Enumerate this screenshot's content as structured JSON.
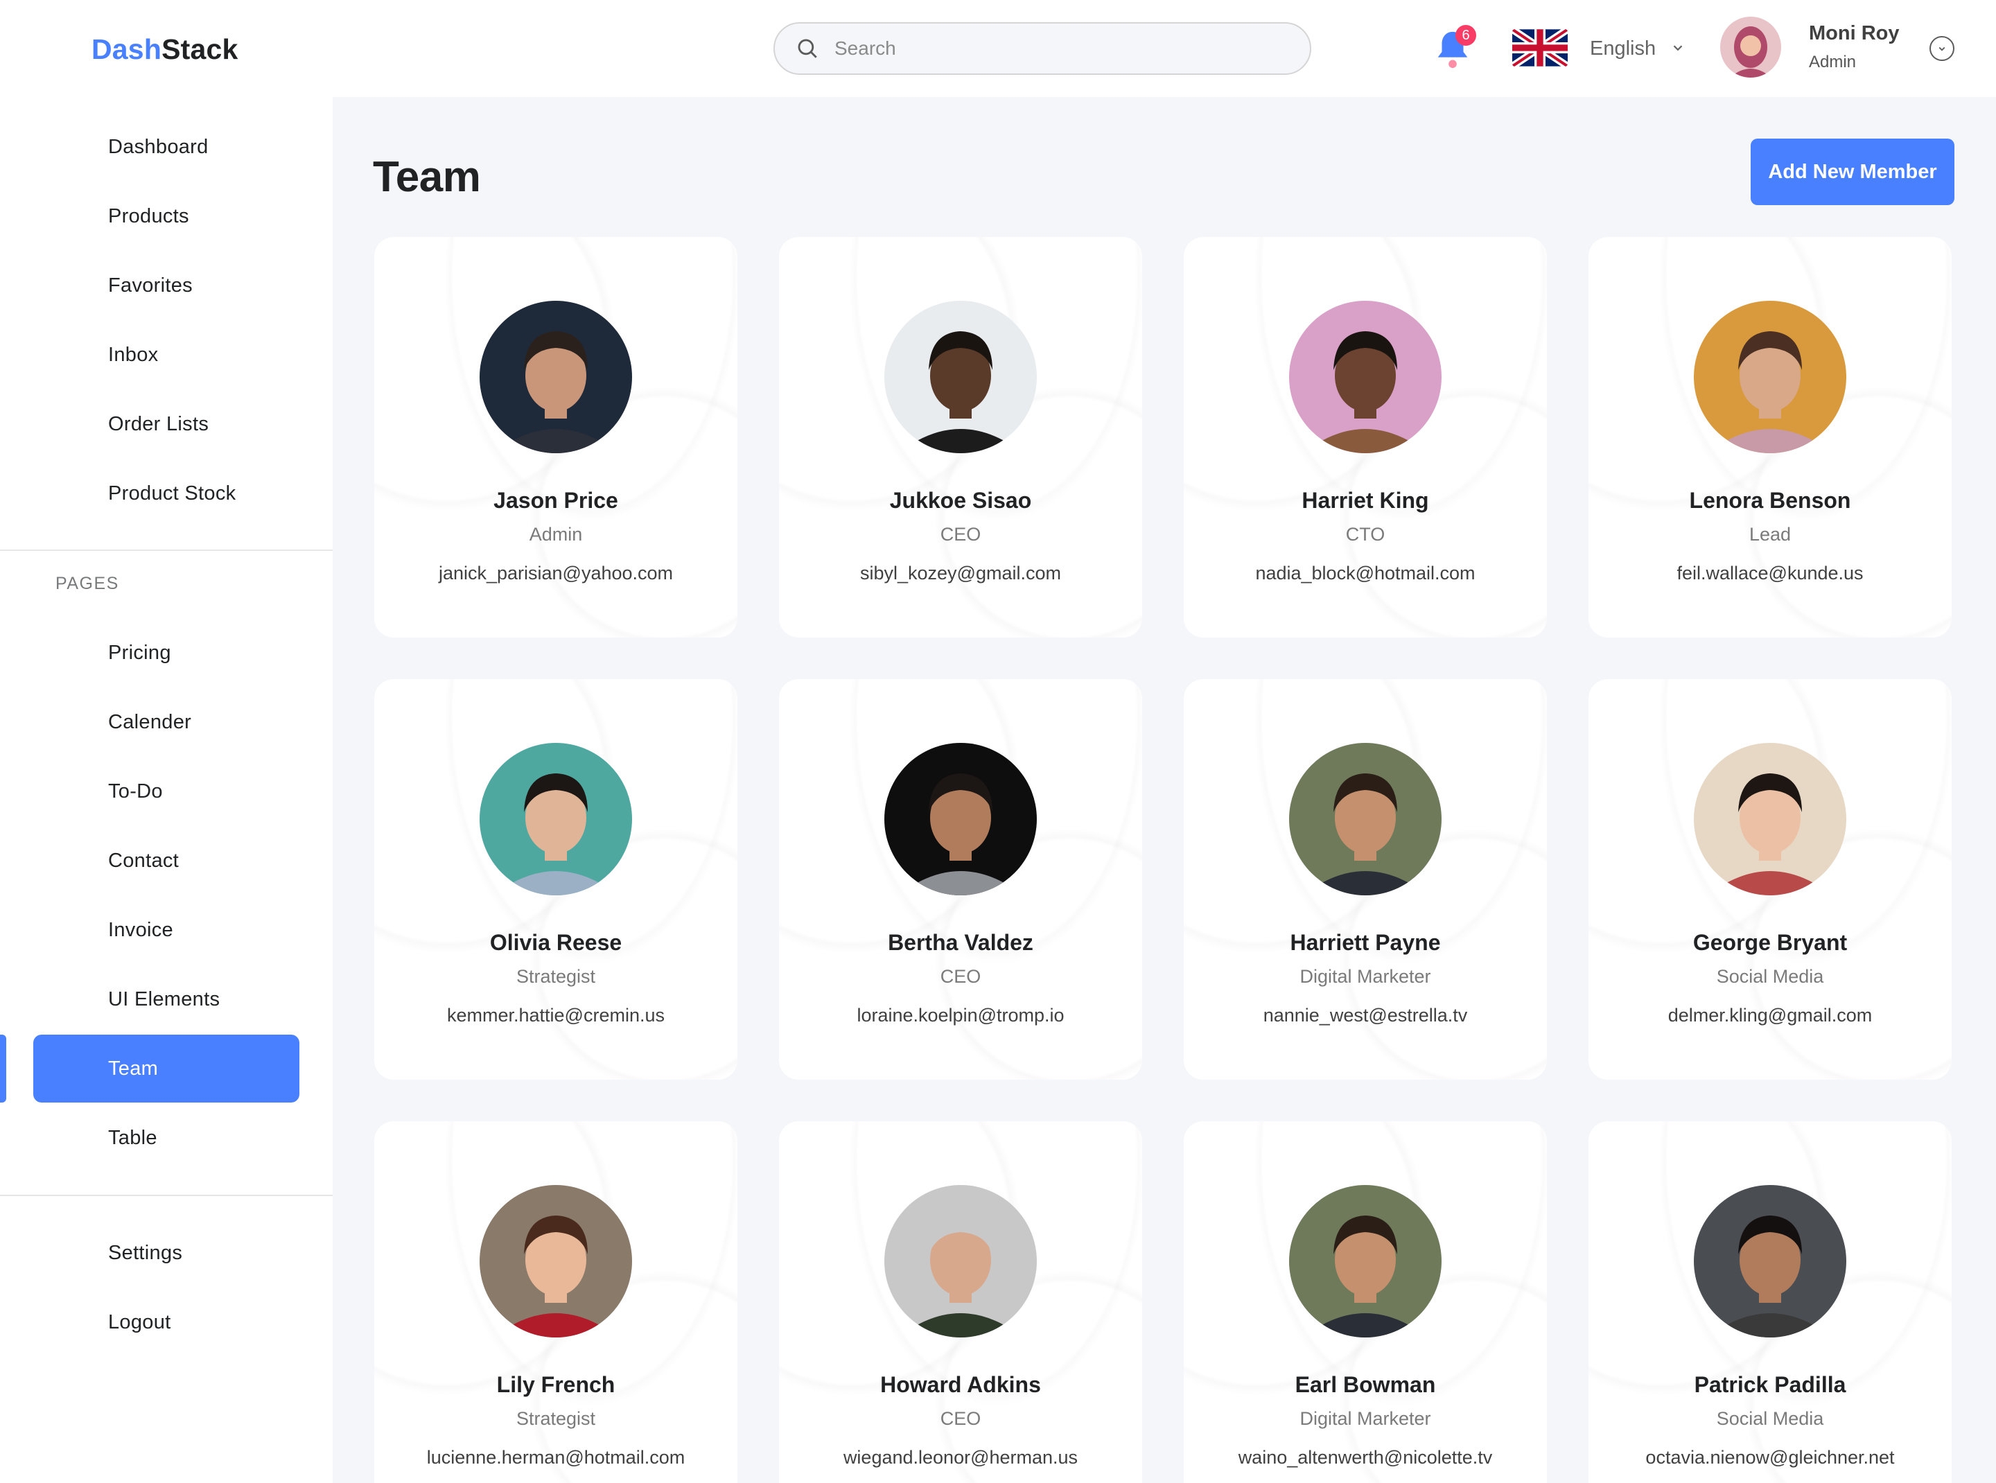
{
  "app": {
    "logo_part1": "Dash",
    "logo_part2": "Stack"
  },
  "colors": {
    "accent": "#4880ff",
    "badge": "#f93c65",
    "background": "#f5f6fa"
  },
  "sidebar": {
    "main_items": [
      {
        "label": "Dashboard"
      },
      {
        "label": "Products"
      },
      {
        "label": "Favorites"
      },
      {
        "label": "Inbox"
      },
      {
        "label": "Order Lists"
      },
      {
        "label": "Product Stock"
      }
    ],
    "pages_label": "PAGES",
    "page_items": [
      {
        "label": "Pricing"
      },
      {
        "label": "Calender"
      },
      {
        "label": "To-Do"
      },
      {
        "label": "Contact"
      },
      {
        "label": "Invoice"
      },
      {
        "label": "UI Elements"
      },
      {
        "label": "Team",
        "active": true
      },
      {
        "label": "Table"
      }
    ],
    "bottom_items": [
      {
        "label": "Settings"
      },
      {
        "label": "Logout"
      }
    ]
  },
  "header": {
    "search_placeholder": "Search",
    "search_icon": "search-icon",
    "notification_count": "6",
    "notification_icon": "bell-icon",
    "language": "English",
    "user": {
      "name": "Moni Roy",
      "role": "Admin"
    }
  },
  "main": {
    "title": "Team",
    "add_button_label": "Add New Member",
    "members": [
      {
        "name": "Jason Price",
        "role": "Admin",
        "email": "janick_parisian@yahoo.com",
        "skin": "#c9967a",
        "hair": "#2a211c",
        "shirt": "#2b2f3a",
        "bg": "#1e2a3a"
      },
      {
        "name": "Jukkoe Sisao",
        "role": "CEO",
        "email": "sibyl_kozey@gmail.com",
        "skin": "#5a3a28",
        "hair": "#1a1411",
        "shirt": "#1c1c1c",
        "bg": "#e8ecef"
      },
      {
        "name": "Harriet King",
        "role": "CTO",
        "email": "nadia_block@hotmail.com",
        "skin": "#6b4330",
        "hair": "#1a1411",
        "shirt": "#8a5a3c",
        "bg": "#d9a0c8"
      },
      {
        "name": "Lenora Benson",
        "role": "Lead",
        "email": "feil.wallace@kunde.us",
        "skin": "#d8a888",
        "hair": "#4a2f22",
        "shirt": "#c89aa8",
        "bg": "#d89a3c"
      },
      {
        "name": "Olivia Reese",
        "role": "Strategist",
        "email": "kemmer.hattie@cremin.us",
        "skin": "#e0b496",
        "hair": "#1c1714",
        "shirt": "#9bb0c4",
        "bg": "#4fa8a0"
      },
      {
        "name": "Bertha Valdez",
        "role": "CEO",
        "email": "loraine.koelpin@tromp.io",
        "skin": "#b07c5c",
        "hair": "#1c1714",
        "shirt": "#8c9094",
        "bg": "#0e0e0e"
      },
      {
        "name": "Harriett Payne",
        "role": "Digital Marketer",
        "email": "nannie_west@estrella.tv",
        "skin": "#c4906e",
        "hair": "#2a1e16",
        "shirt": "#2a2e36",
        "bg": "#6e7a5a"
      },
      {
        "name": "George Bryant",
        "role": "Social Media",
        "email": "delmer.kling@gmail.com",
        "skin": "#ecc0a4",
        "hair": "#1e1612",
        "shirt": "#b84a4a",
        "bg": "#e6d8c4"
      },
      {
        "name": "Lily French",
        "role": "Strategist",
        "email": "lucienne.herman@hotmail.com",
        "skin": "#e8b898",
        "hair": "#4a2a1c",
        "shirt": "#b01c2a",
        "bg": "#8a7a6a"
      },
      {
        "name": "Howard Adkins",
        "role": "CEO",
        "email": "wiegand.leonor@herman.us",
        "skin": "#d8a88c",
        "hair": "#c8c8c8",
        "shirt": "#2e3a2a",
        "bg": "#c8c8c8"
      },
      {
        "name": "Earl Bowman",
        "role": "Digital Marketer",
        "email": "waino_altenwerth@nicolette.tv",
        "skin": "#c4906e",
        "hair": "#2a1e16",
        "shirt": "#2a2e36",
        "bg": "#6e7a5a"
      },
      {
        "name": "Patrick Padilla",
        "role": "Social Media",
        "email": "octavia.nienow@gleichner.net",
        "skin": "#b07c5c",
        "hair": "#141010",
        "shirt": "#3a3a3a",
        "bg": "#4a4e52"
      }
    ]
  }
}
